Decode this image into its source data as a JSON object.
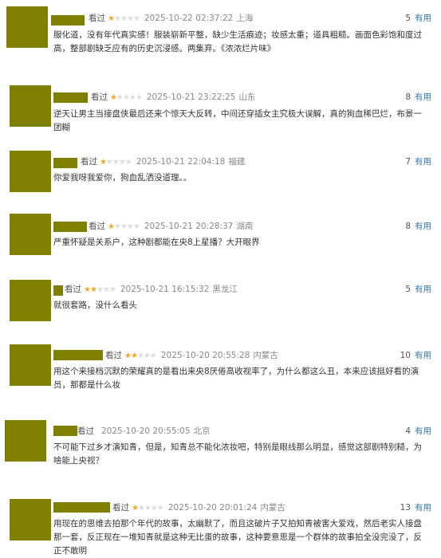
{
  "seen_label": "看过",
  "useful_label": "有用",
  "colors": {
    "star_on": "#f5a623",
    "star_off": "#dddddd",
    "link": "#3377aa",
    "mask": "#808000"
  },
  "reviews": [
    {
      "stars": 1,
      "time": "2025-10-22 02:37:22",
      "loc": "上海",
      "useful": "5",
      "text": "服化道，没有年代真实感！服装崭新平整，缺少生活痕迹；妆感太重；道具粗糙。画面色彩饱和度过高，整部剧缺乏应有的历史沉浸感。两集弃。《浓浓烂片味》"
    },
    {
      "stars": 1,
      "time": "2025-10-21 23:22:25",
      "loc": "山东",
      "useful": "8",
      "text": "逆天让男主当接盘侠最后还来个惊天大反转，中间还穿插女主究极大误解，真的狗血稀巴烂，布景一团糊"
    },
    {
      "stars": 1,
      "time": "2025-10-21 22:04:18",
      "loc": "福建",
      "useful": "7",
      "text": "你爱我呀我爱你，狗血乱洒没道理。。"
    },
    {
      "stars": 1,
      "time": "2025-10-21 20:28:37",
      "loc": "湖南",
      "useful": "8",
      "text": "严重怀疑是关系户，这种剧都能在央8上星播？大开眼界"
    },
    {
      "stars": 2,
      "time": "2025-10-21 16:15:32",
      "loc": "黑龙江",
      "useful": "5",
      "text": "就很套路，没什么看头"
    },
    {
      "stars": 2,
      "time": "2025-10-20 20:55:28",
      "loc": "内蒙古",
      "useful": "10",
      "text": "用这个来接档沉默的荣耀真的是看出来央8厌倦高收视率了，为什么都这么丑，本来应该挺好看的演员，那都是什么妆"
    },
    {
      "stars": 0,
      "time": "2025-10-20 20:55:05",
      "loc": "北京",
      "useful": "4",
      "text": "不可能下过乡才演知青，但是，知青总不能化浓妆吧，特别是眼线那么明显，感觉这部剧特别糙，为啥能上央视？"
    },
    {
      "stars": 1,
      "time": "2025-10-20 20:01:24",
      "loc": "内蒙古",
      "useful": "13",
      "text": "用现在的思维去拍那个年代的故事，太幽默了，而且这破片子又拍知青被害大爱戏，然后老实人接盘那一套，反正现在一堆知青就是这种无比蛋的故事，这种要意思是一个群体的故事拍全没完没了，反正不敢明"
    }
  ]
}
